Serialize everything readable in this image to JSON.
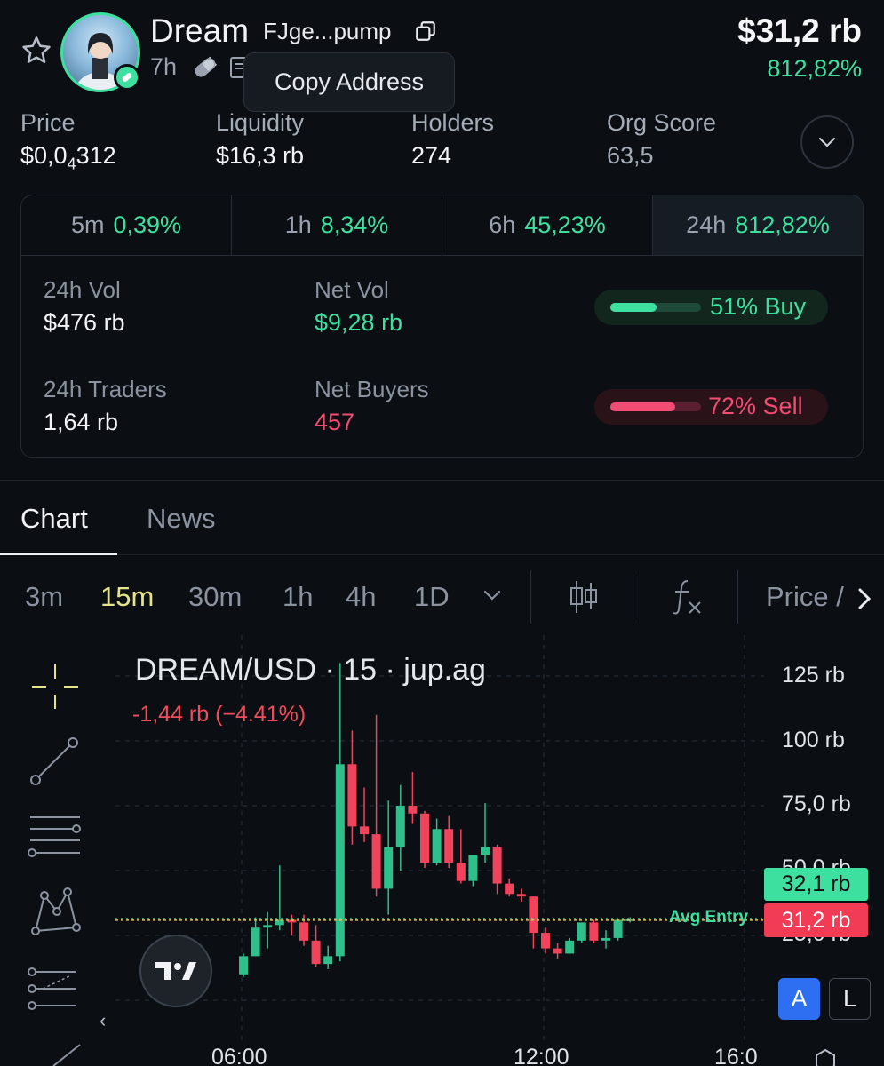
{
  "header": {
    "token_name": "Dream",
    "address_short": "FJge...pump",
    "age": "7h",
    "tooltip": "Copy Address",
    "market_cap": "$31,2 rb",
    "market_cap_change": "812,82%"
  },
  "stats": [
    {
      "label": "Price",
      "value_prefix": "$0,0",
      "value_sub": "4",
      "value_suffix": "312"
    },
    {
      "label": "Liquidity",
      "value": "$16,3 rb"
    },
    {
      "label": "Holders",
      "value": "274"
    },
    {
      "label": "Org Score",
      "value": "63,5"
    }
  ],
  "timeframes": [
    {
      "label": "5m",
      "value": "0,39%",
      "active": false
    },
    {
      "label": "1h",
      "value": "8,34%",
      "active": false
    },
    {
      "label": "6h",
      "value": "45,23%",
      "active": false
    },
    {
      "label": "24h",
      "value": "812,82%",
      "active": true
    }
  ],
  "metrics": {
    "vol_label": "24h Vol",
    "vol_value": "$476 rb",
    "netvol_label": "Net Vol",
    "netvol_value": "$9,28 rb",
    "traders_label": "24h Traders",
    "traders_value": "1,64 rb",
    "netbuyers_label": "Net Buyers",
    "netbuyers_value": "457",
    "buy_label": "51% Buy",
    "buy_fraction": 0.51,
    "sell_label": "72% Sell",
    "sell_fraction": 0.72
  },
  "tabs": {
    "chart": "Chart",
    "news": "News"
  },
  "toolbar": {
    "intervals": [
      "3m",
      "15m",
      "30m",
      "1h",
      "4h",
      "1D"
    ],
    "active_interval": "15m",
    "price_label": "Price / "
  },
  "chart": {
    "title": "DREAM/USD · 15 · jup.ag",
    "change": "-1,44 rb (−4.41%)",
    "price_current_green": "32,1 rb",
    "price_current_red": "31,2 rb",
    "avg_entry_label": "Avg Entry",
    "btn_a": "A",
    "btn_l": "L",
    "collapse_glyph": "‹"
  },
  "chart_data": {
    "type": "candlestick",
    "title": "DREAM/USD · 15 · jup.ag",
    "y_ticks": [
      "125 rb",
      "100 rb",
      "75,0 rb",
      "50,0 rb",
      "25,0 rb"
    ],
    "x_ticks": [
      "06:00",
      "12:00",
      "16:0"
    ],
    "ylim": [
      0,
      135
    ],
    "candles": [
      {
        "o": 10,
        "h": 18,
        "l": 9,
        "c": 17
      },
      {
        "o": 17,
        "h": 32,
        "l": 17,
        "c": 28
      },
      {
        "o": 28,
        "h": 34,
        "l": 20,
        "c": 29
      },
      {
        "o": 29,
        "h": 52,
        "l": 27,
        "c": 31
      },
      {
        "o": 31,
        "h": 33,
        "l": 25,
        "c": 30
      },
      {
        "o": 30,
        "h": 33,
        "l": 21,
        "c": 23
      },
      {
        "o": 23,
        "h": 29,
        "l": 13,
        "c": 14
      },
      {
        "o": 14,
        "h": 21,
        "l": 12,
        "c": 17
      },
      {
        "o": 17,
        "h": 130,
        "l": 15,
        "c": 91
      },
      {
        "o": 91,
        "h": 104,
        "l": 60,
        "c": 67
      },
      {
        "o": 67,
        "h": 82,
        "l": 61,
        "c": 64
      },
      {
        "o": 64,
        "h": 110,
        "l": 40,
        "c": 43
      },
      {
        "o": 43,
        "h": 77,
        "l": 33,
        "c": 59
      },
      {
        "o": 59,
        "h": 83,
        "l": 50,
        "c": 75
      },
      {
        "o": 75,
        "h": 88,
        "l": 68,
        "c": 72
      },
      {
        "o": 72,
        "h": 73,
        "l": 51,
        "c": 53
      },
      {
        "o": 53,
        "h": 70,
        "l": 52,
        "c": 66
      },
      {
        "o": 66,
        "h": 71,
        "l": 51,
        "c": 53
      },
      {
        "o": 53,
        "h": 66,
        "l": 45,
        "c": 46
      },
      {
        "o": 46,
        "h": 56,
        "l": 44,
        "c": 56
      },
      {
        "o": 56,
        "h": 76,
        "l": 53,
        "c": 59
      },
      {
        "o": 59,
        "h": 60,
        "l": 41,
        "c": 45
      },
      {
        "o": 45,
        "h": 47,
        "l": 40,
        "c": 41
      },
      {
        "o": 41,
        "h": 43,
        "l": 38,
        "c": 40
      },
      {
        "o": 40,
        "h": 40,
        "l": 20,
        "c": 26
      },
      {
        "o": 26,
        "h": 28,
        "l": 18,
        "c": 20
      },
      {
        "o": 20,
        "h": 22,
        "l": 16,
        "c": 18
      },
      {
        "o": 18,
        "h": 24,
        "l": 18,
        "c": 23
      },
      {
        "o": 23,
        "h": 30,
        "l": 22,
        "c": 30
      },
      {
        "o": 30,
        "h": 31,
        "l": 22,
        "c": 23
      },
      {
        "o": 23,
        "h": 27,
        "l": 20,
        "c": 24
      },
      {
        "o": 24,
        "h": 31,
        "l": 23,
        "c": 31
      },
      {
        "o": 31,
        "h": 32,
        "l": 30,
        "c": 31.2
      }
    ],
    "current_price_rb": 31.2
  }
}
